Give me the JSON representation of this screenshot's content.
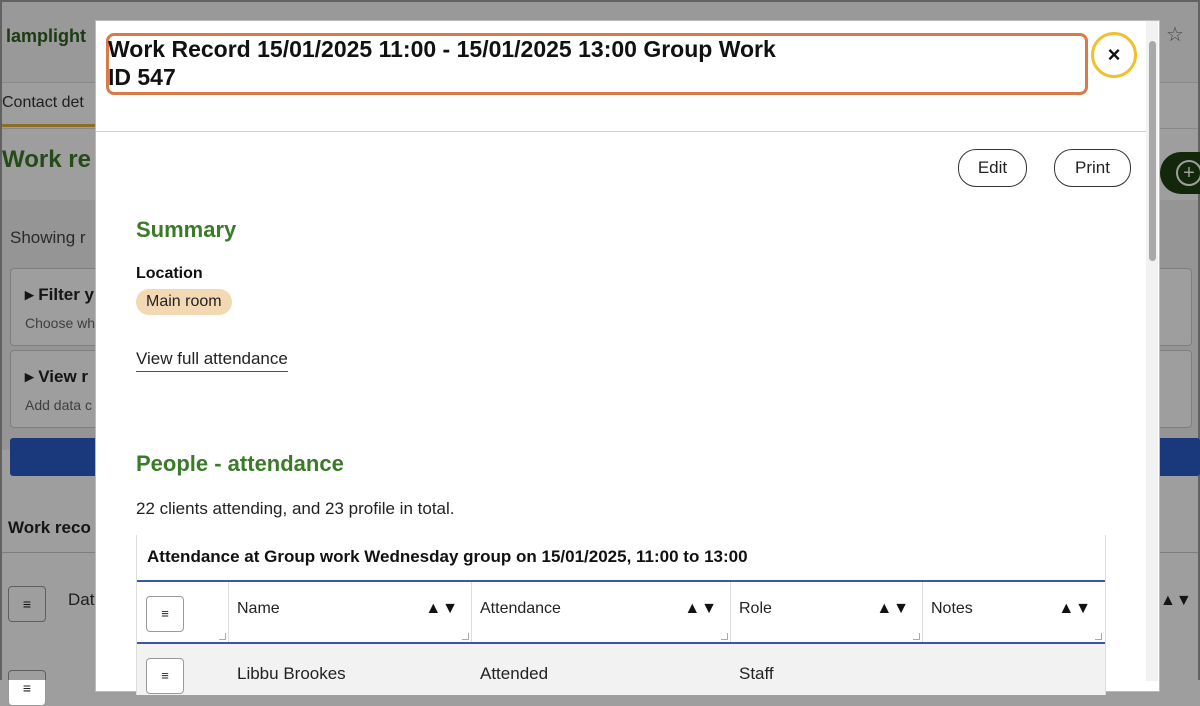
{
  "background": {
    "logo": "lamplight",
    "tab": "Contact det",
    "title": "Work re",
    "showing": "Showing r",
    "filter_card": {
      "heading": "Filter y",
      "sub": "Choose wh"
    },
    "view_card": {
      "heading": "View r",
      "sub": "Add data c"
    },
    "work_records_label": "Work reco",
    "date_col": "Dat",
    "menu_glyph": "≡",
    "sort_glyph": "▲▼",
    "add_glyph": "+"
  },
  "browser": {
    "extension_icon": "puzzle-icon",
    "star_icon": "star-icon",
    "extension_glyph": "⧉",
    "star_glyph": "☆"
  },
  "modal": {
    "title_line1": "Work Record 15/01/2025 11:00 - 15/01/2025 13:00 Group Work",
    "title_line2": "ID 547",
    "close_label": "×",
    "edit_label": "Edit",
    "print_label": "Print",
    "summary_heading": "Summary",
    "location_label": "Location",
    "location_value": "Main room",
    "view_attendance_link": "View full attendance",
    "people_heading": "People - attendance",
    "attendance_summary": "22 clients attending, and 23 profile in total.",
    "table": {
      "caption": "Attendance at Group work Wednesday group on 15/01/2025, 11:00 to 13:00",
      "menu_glyph": "≡",
      "sort_glyph": "▲▼",
      "columns": [
        "Name",
        "Attendance",
        "Role",
        "Notes"
      ],
      "rows": [
        {
          "name": "Libbu Brookes",
          "attendance": "Attended",
          "role": "Staff",
          "notes": ""
        }
      ]
    }
  }
}
